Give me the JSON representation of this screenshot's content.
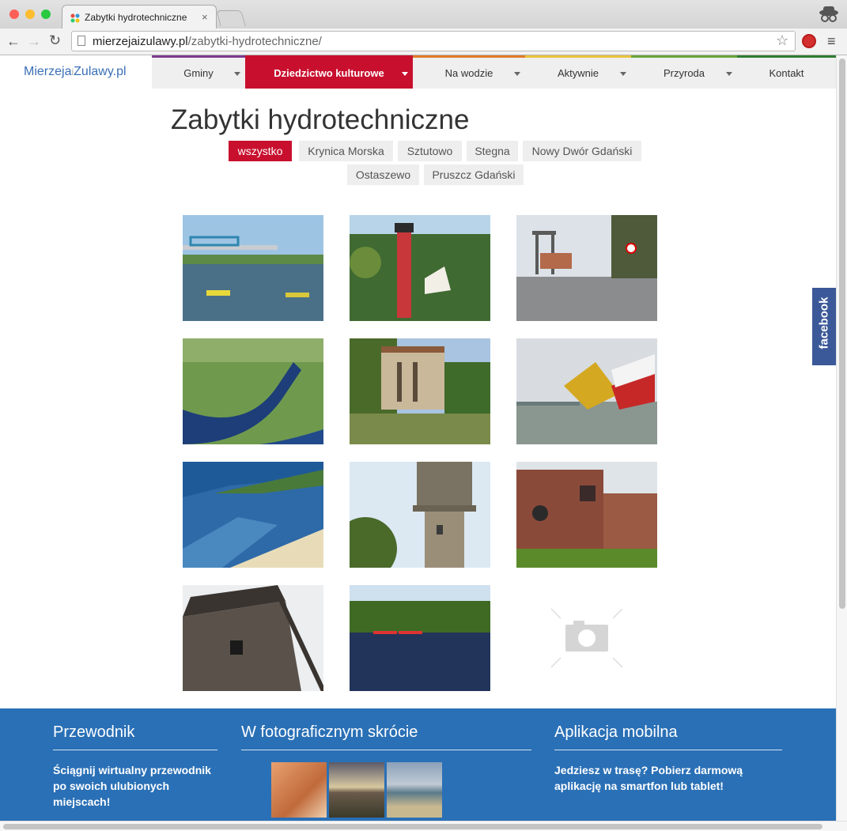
{
  "browser": {
    "tab_title": "Zabytki hydrotechniczne",
    "url_domain": "mierzejaizulawy.pl",
    "url_path": "/zabytki-hydrotechniczne/"
  },
  "site": {
    "logo_part1": "Mierzeja",
    "logo_sep": "i",
    "logo_part2": "Zulawy.pl"
  },
  "nav": [
    {
      "label": "Gminy",
      "dropdown": true,
      "color": "#7d3a8e"
    },
    {
      "label": "Dziedzictwo kulturowe",
      "dropdown": true,
      "active": true,
      "color": "#c8102e"
    },
    {
      "label": "Na wodzie",
      "dropdown": true,
      "color": "#e07b2a"
    },
    {
      "label": "Aktywnie",
      "dropdown": true,
      "color": "#e8c23a"
    },
    {
      "label": "Przyroda",
      "dropdown": true,
      "color": "#6aa53a"
    },
    {
      "label": "Kontakt",
      "dropdown": false,
      "color": "#2e7d32"
    }
  ],
  "page_title": "Zabytki hydrotechniczne",
  "filters": [
    "wszystko",
    "Krynica Morska",
    "Sztutowo",
    "Stegna",
    "Nowy Dwór Gdański",
    "Ostaszewo",
    "Pruszcz Gdański"
  ],
  "active_filter": "wszystko",
  "gallery": [
    {
      "name": "bridge-river-photo"
    },
    {
      "name": "lighthouse-photo"
    },
    {
      "name": "drawbridge-road-photo"
    },
    {
      "name": "canal-aerial-photo"
    },
    {
      "name": "pump-station-photo"
    },
    {
      "name": "lift-bridge-photo"
    },
    {
      "name": "lagoon-aerial-photo"
    },
    {
      "name": "water-tower-photo"
    },
    {
      "name": "brick-ruin-photo"
    },
    {
      "name": "windmill-photo"
    },
    {
      "name": "kayaks-photo"
    },
    {
      "name": "placeholder-camera-icon"
    }
  ],
  "footer": {
    "guide_title": "Przewodnik",
    "guide_text": "Ściągnij wirtualny przewodnik po swoich ulubionych miejscach!",
    "photo_title": "W fotograficznym skrócie",
    "app_title": "Aplikacja mobilna",
    "app_text": "Jedziesz w trasę? Pobierz darmową aplikację na smartfon lub tablet!"
  },
  "facebook_label": "facebook"
}
